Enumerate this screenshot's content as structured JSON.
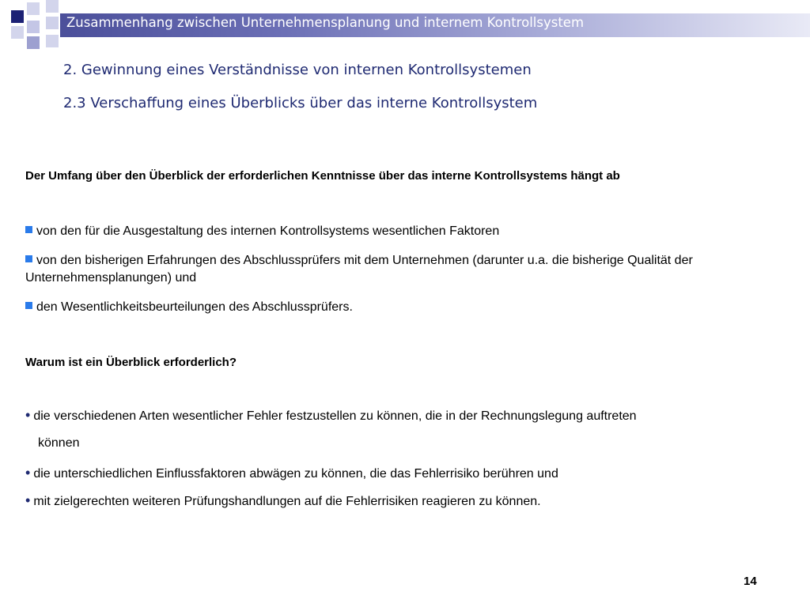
{
  "header": {
    "title": "Zusammenhang zwischen Unternehmensplanung und internem Kontrollsystem"
  },
  "headings": {
    "section": "2. Gewinnung eines Verständnisse von internen Kontrollsystemen",
    "subsection": "2.3 Verschaffung eines Überblicks über das interne Kontrollsystem"
  },
  "intro": "Der Umfang über den Überblick der erforderlichen Kenntnisse über das interne Kontrollsystems hängt ab",
  "factors": [
    "von den für die Ausgestaltung des internen Kontrollsystems wesentlichen Faktoren",
    "von den bisherigen Erfahrungen des Abschlussprüfers mit dem Unternehmen (darunter u.a. die bisherige Qualität der Unternehmensplanungen) und",
    "den Wesentlichkeitsbeurteilungen des Abschlussprüfers."
  ],
  "question": "Warum ist ein Überblick erforderlich?",
  "reasons": [
    "die verschiedenen Arten wesentlicher Fehler festzustellen zu können, die in der Rechnungslegung auftreten",
    "können",
    "die unterschiedlichen Einflussfaktoren abwägen zu können, die das Fehlerrisiko berühren und",
    "mit zielgerechten weiteren Prüfungshandlungen auf die Fehlerrisiken reagieren zu können."
  ],
  "page_number": "14",
  "colors": {
    "header_dark": "#4b4f9a",
    "heading_text": "#1f2a72",
    "square_bullet": "#2a7bea"
  }
}
